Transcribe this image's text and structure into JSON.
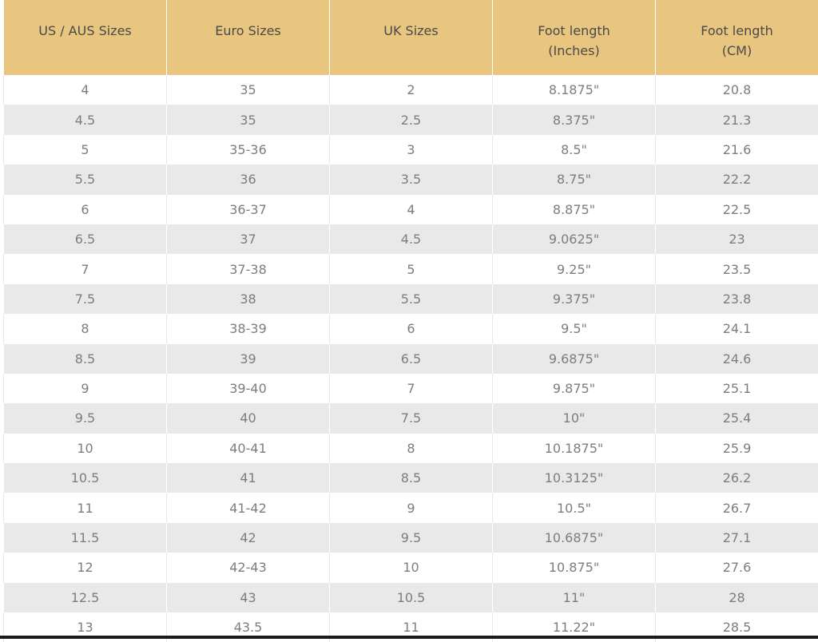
{
  "headers": [
    {
      "line1": "US / AUS Sizes",
      "line2": ""
    },
    {
      "line1": "Euro Sizes",
      "line2": ""
    },
    {
      "line1": "UK Sizes",
      "line2": ""
    },
    {
      "line1": "Foot length",
      "line2": "(Inches)"
    },
    {
      "line1": "Foot length",
      "line2": "(CM)"
    }
  ],
  "rows": [
    [
      "4",
      "35",
      "2",
      "8.1875\"",
      "20.8"
    ],
    [
      "4.5",
      "35",
      "2.5",
      "8.375\"",
      "21.3"
    ],
    [
      "5",
      "35-36",
      "3",
      "8.5\"",
      "21.6"
    ],
    [
      "5.5",
      "36",
      "3.5",
      "8.75\"",
      "22.2"
    ],
    [
      "6",
      "36-37",
      "4",
      "8.875\"",
      "22.5"
    ],
    [
      "6.5",
      "37",
      "4.5",
      "9.0625\"",
      "23"
    ],
    [
      "7",
      "37-38",
      "5",
      "9.25\"",
      "23.5"
    ],
    [
      "7.5",
      "38",
      "5.5",
      "9.375\"",
      "23.8"
    ],
    [
      "8",
      "38-39",
      "6",
      "9.5\"",
      "24.1"
    ],
    [
      "8.5",
      "39",
      "6.5",
      "9.6875\"",
      "24.6"
    ],
    [
      "9",
      "39-40",
      "7",
      "9.875\"",
      "25.1"
    ],
    [
      "9.5",
      "40",
      "7.5",
      "10\"",
      "25.4"
    ],
    [
      "10",
      "40-41",
      "8",
      "10.1875\"",
      "25.9"
    ],
    [
      "10.5",
      "41",
      "8.5",
      "10.3125\"",
      "26.2"
    ],
    [
      "11",
      "41-42",
      "9",
      "10.5\"",
      "26.7"
    ],
    [
      "11.5",
      "42",
      "9.5",
      "10.6875\"",
      "27.1"
    ],
    [
      "12",
      "42-43",
      "10",
      "10.875\"",
      "27.6"
    ],
    [
      "12.5",
      "43",
      "10.5",
      "11\"",
      "28"
    ],
    [
      "13",
      "43.5",
      "11",
      "11.22\"",
      "28.5"
    ]
  ],
  "colors": {
    "header_bg": "#e8c680",
    "stripe_bg": "#e9e9e9",
    "cell_text": "#7d7d7d",
    "header_text": "#4a4a4a"
  }
}
